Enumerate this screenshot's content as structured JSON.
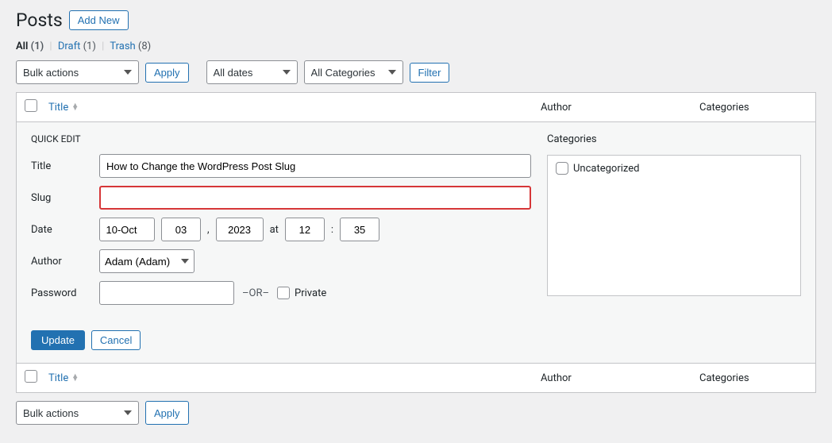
{
  "header": {
    "title": "Posts",
    "add_new": "Add New"
  },
  "filters": {
    "all": "All",
    "all_count": "(1)",
    "draft": "Draft",
    "draft_count": "(1)",
    "trash": "Trash",
    "trash_count": "(8)"
  },
  "toolbar": {
    "bulk": "Bulk actions",
    "apply": "Apply",
    "dates": "All dates",
    "cats": "All Categories",
    "filter": "Filter"
  },
  "table": {
    "title": "Title",
    "author": "Author",
    "categories": "Categories"
  },
  "qe": {
    "heading": "QUICK EDIT",
    "title_label": "Title",
    "title_value": "How to Change the WordPress Post Slug",
    "slug_label": "Slug",
    "slug_value": "",
    "date_label": "Date",
    "month": "10-Oct",
    "day": "03",
    "comma": ",",
    "year": "2023",
    "at": "at",
    "hour": "12",
    "colon": ":",
    "min": "35",
    "author_label": "Author",
    "author_value": "Adam (Adam)",
    "password_label": "Password",
    "or": "–OR–",
    "private": "Private",
    "cats_heading": "Categories",
    "uncat": "Uncategorized",
    "update": "Update",
    "cancel": "Cancel"
  },
  "bottom": {
    "bulk": "Bulk actions",
    "apply": "Apply"
  }
}
